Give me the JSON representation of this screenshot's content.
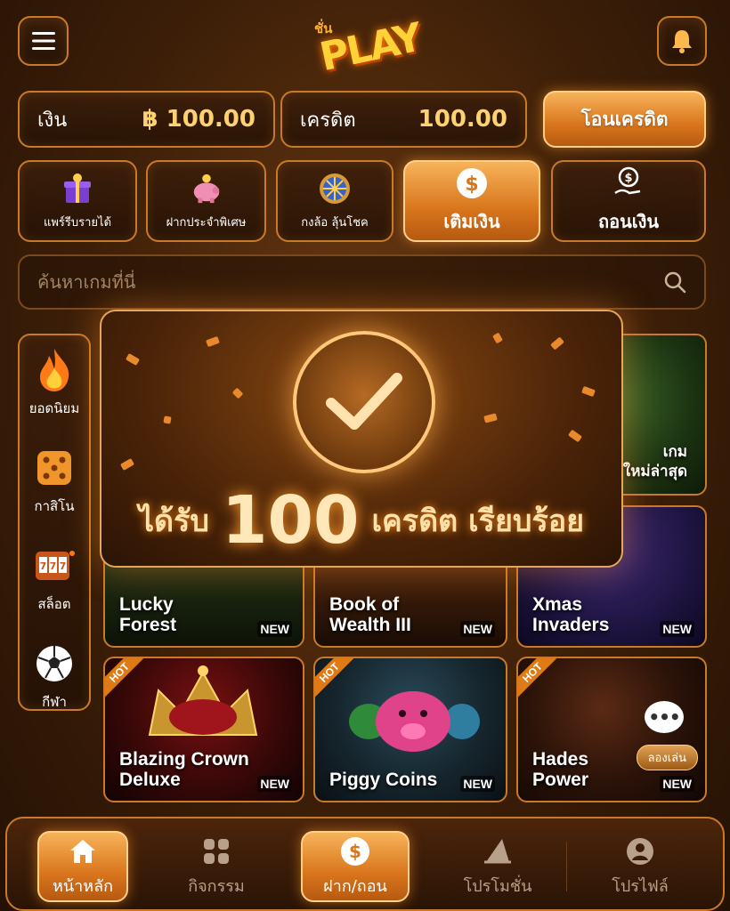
{
  "header": {
    "logo_small": "ชั่น",
    "logo_big": "PLAY",
    "menu_icon": "menu-icon",
    "bell_icon": "bell-icon"
  },
  "balance": {
    "money_label": "เงิน",
    "money_value": "฿ 100.00",
    "credit_label": "เครดิต",
    "credit_value": "100.00",
    "transfer_label": "โอนเครดิต"
  },
  "quick_actions": [
    {
      "label": "แพร์รีบรายได้",
      "icon": "gift-icon"
    },
    {
      "label": "ฝากประจำพิเศษ",
      "icon": "piggy-bank-icon"
    },
    {
      "label": "กงล้อ ลุ้นโชค",
      "icon": "wheel-icon"
    },
    {
      "label": "เติมเงิน",
      "icon": "dollar-icon"
    },
    {
      "label": "ถอนเงิน",
      "icon": "withdraw-icon"
    }
  ],
  "search": {
    "placeholder": "ค้นหาเกมที่นี่"
  },
  "categories": [
    {
      "label": "ยอดนิยม",
      "icon": "fire-icon"
    },
    {
      "label": "กาสิโน",
      "icon": "dice-icon"
    },
    {
      "label": "สล็อต",
      "icon": "slot-icon"
    },
    {
      "label": "กีฬา",
      "icon": "soccer-icon"
    }
  ],
  "featured": {
    "line1": "เกม",
    "line2": "ใหม่ล่าสุด"
  },
  "games": [
    {
      "title1": "Lucky",
      "title2": "Forest",
      "badge": "NEW"
    },
    {
      "title1": "Book of",
      "title2": "Wealth III",
      "badge": "NEW"
    },
    {
      "title1": "Xmas",
      "title2": "Invaders",
      "badge": "NEW"
    },
    {
      "title1": "Blazing Crown",
      "title2": "Deluxe",
      "badge": "NEW",
      "hot": "HOT"
    },
    {
      "title1": "Piggy Coins",
      "title2": "",
      "badge": "NEW",
      "hot": "HOT"
    },
    {
      "title1": "Hades",
      "title2": "Power",
      "badge": "NEW",
      "hot": "HOT",
      "try": "ลองเล่น",
      "chat": "•••"
    }
  ],
  "overlay": {
    "msg_prefix": "ได้รับ",
    "amount": "100",
    "msg_suffix": "เครดิต เรียบร้อย"
  },
  "bottom_nav": [
    {
      "label": "หน้าหลัก",
      "icon": "home-icon"
    },
    {
      "label": "กิจกรรม",
      "icon": "grid-icon"
    },
    {
      "label": "ฝาก/ถอน",
      "icon": "dollar-icon"
    },
    {
      "label": "โปรโมชั่น",
      "icon": "promo-icon"
    },
    {
      "label": "โปรไฟล์",
      "icon": "profile-icon"
    }
  ],
  "colors": {
    "accent": "#e07a14",
    "gold": "#ffd271",
    "background": "#3d1f08"
  }
}
